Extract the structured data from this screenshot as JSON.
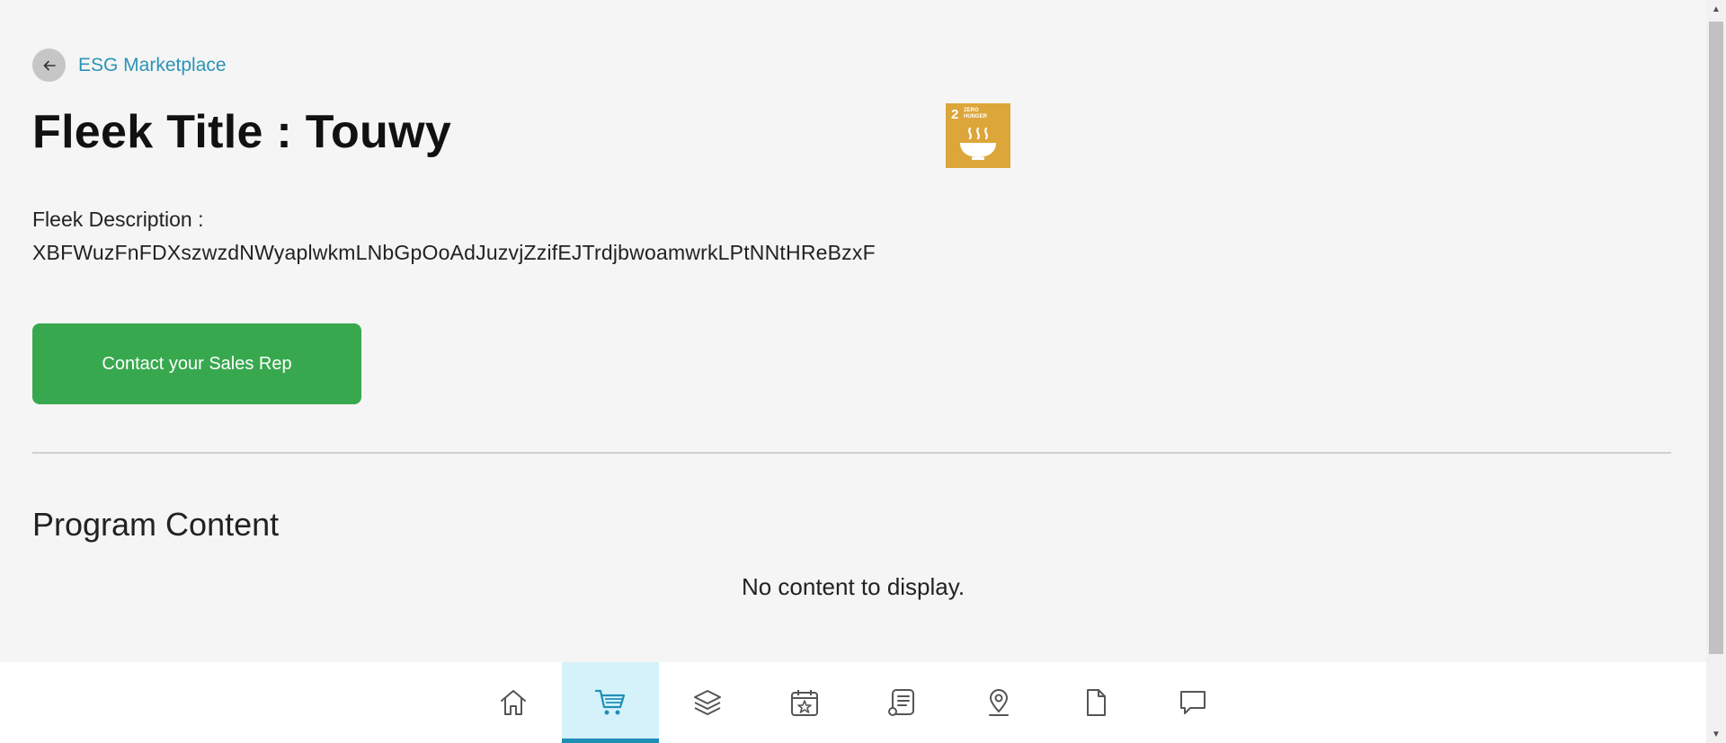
{
  "breadcrumb": {
    "label": "ESG Marketplace"
  },
  "page": {
    "title": "Fleek Title : Touwy",
    "description_label": "Fleek Description :",
    "description_text": "XBFWuzFnFDXszwzdNWyaplwkmLNbGpOoAdJuzvjZzifEJTrdjbwoamwrkLPtNNtHReBzxF"
  },
  "sdg_badge": {
    "number": "2",
    "label": "ZERO HUNGER",
    "color": "#dda63a"
  },
  "actions": {
    "contact_label": "Contact your Sales Rep",
    "contact_color": "#38a84f"
  },
  "program": {
    "section_title": "Program Content",
    "empty_message": "No content to display."
  },
  "nav": {
    "items": [
      {
        "icon": "home-icon",
        "active": false
      },
      {
        "icon": "cart-icon",
        "active": true
      },
      {
        "icon": "layers-icon",
        "active": false
      },
      {
        "icon": "calendar-star-icon",
        "active": false
      },
      {
        "icon": "document-list-icon",
        "active": false
      },
      {
        "icon": "map-pin-icon",
        "active": false
      },
      {
        "icon": "file-icon",
        "active": false
      },
      {
        "icon": "chat-icon",
        "active": false
      }
    ],
    "active_color": "#1f8fb5"
  }
}
